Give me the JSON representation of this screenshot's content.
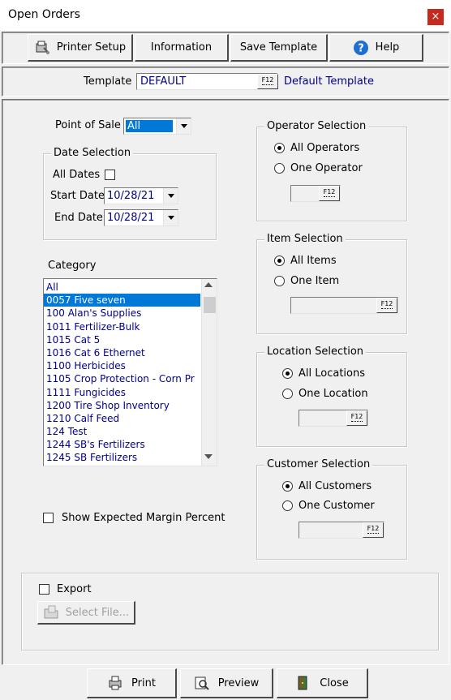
{
  "window": {
    "title": "Open Orders",
    "close_glyph": "×"
  },
  "toolbar": {
    "printer_setup": "Printer Setup",
    "information": "Information",
    "save_template": "Save Template",
    "help": "Help"
  },
  "template": {
    "label": "Template",
    "value": "DEFAULT",
    "f12": "F12",
    "description": "Default Template"
  },
  "point_of_sale": {
    "label": "Point of Sale",
    "value": "All"
  },
  "date_selection": {
    "title": "Date Selection",
    "all_dates_label": "All Dates",
    "all_dates_checked": false,
    "start_label": "Start Date",
    "start_value": "10/28/21",
    "end_label": "End Date",
    "end_value": "10/28/21"
  },
  "category": {
    "label": "Category",
    "items": [
      "All",
      "0057 Five seven",
      "100 Alan's Supplies",
      "1011 Fertilizer-Bulk",
      "1015 Cat 5",
      "1016 Cat 6 Ethernet",
      "1100 Herbicides",
      "1105 Crop Protection - Corn Pr",
      "1111 Fungicides",
      "1200 Tire Shop Inventory",
      "1210 Calf Feed",
      "124 Test",
      "1244 SB's Fertilizers",
      "1245 SB Fertilizers"
    ],
    "selected_index": 1
  },
  "show_margin": {
    "label": "Show Expected Margin Percent",
    "checked": false
  },
  "operator_selection": {
    "title": "Operator Selection",
    "option_all": "All Operators",
    "option_one": "One Operator",
    "f12": "F12"
  },
  "item_selection": {
    "title": "Item Selection",
    "option_all": "All Items",
    "option_one": "One Item",
    "f12": "F12"
  },
  "location_selection": {
    "title": "Location Selection",
    "option_all": "All Locations",
    "option_one": "One Location",
    "f12": "F12"
  },
  "customer_selection": {
    "title": "Customer Selection",
    "option_all": "All Customers",
    "option_one": "One Customer",
    "f12": "F12"
  },
  "export": {
    "label": "Export",
    "checked": false,
    "select_file": "Select File..."
  },
  "bottom": {
    "print": "Print",
    "preview": "Preview",
    "close": "Close"
  },
  "colors": {
    "accent": "#0078d7",
    "link_text": "#00008b",
    "close_red": "#c42b1c"
  }
}
